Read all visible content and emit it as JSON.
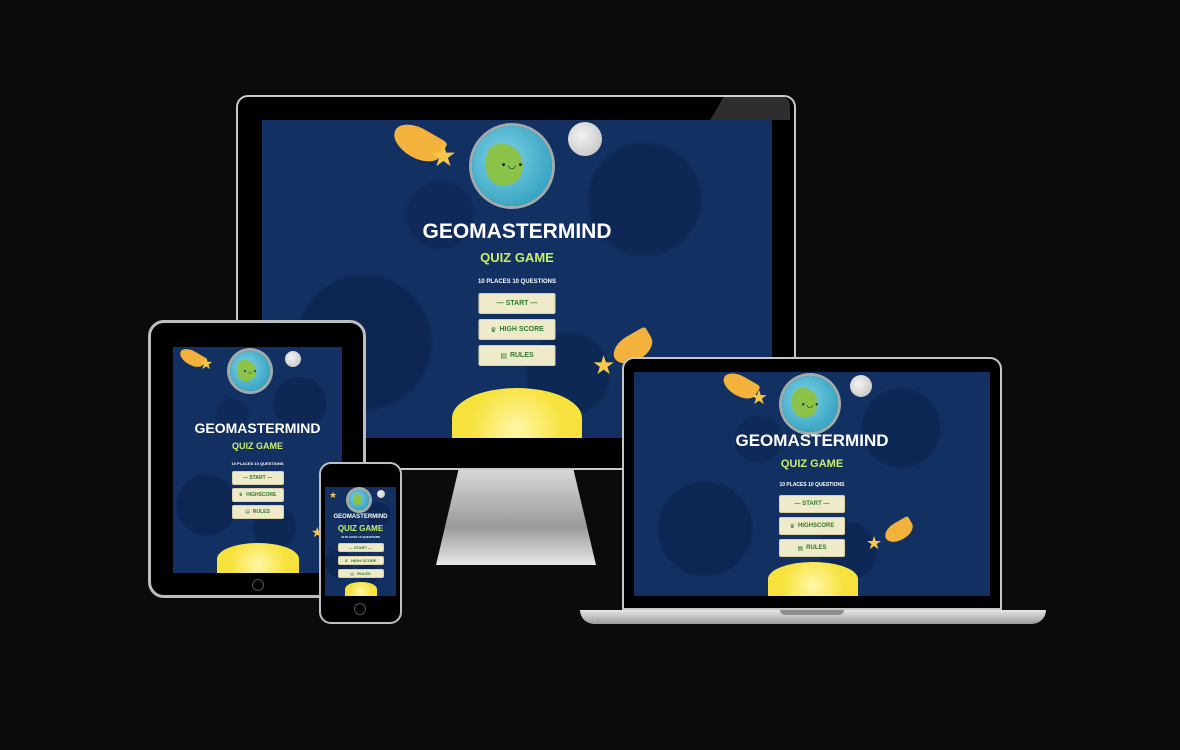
{
  "game": {
    "title": "GEOMASTERMIND",
    "subtitle": "QUIZ GAME",
    "tagline": "10 PLACES 10 QUESTIONS",
    "buttons": {
      "start": "— START —",
      "highscore": "HIGH SCORE",
      "rules": "RULES"
    },
    "highscore_short": "HIGHSCORE"
  },
  "icons": {
    "highscore": "crown-icon",
    "rules": "book-icon"
  },
  "colors": {
    "background": "#0b0b0b",
    "screen": "#123062",
    "title": "#ffffff",
    "subtitle": "#c9f06b",
    "button_bg": "#efeac9",
    "button_text": "#2f7a2f",
    "sun": "#f7e23d",
    "star": "#f6c84a"
  }
}
